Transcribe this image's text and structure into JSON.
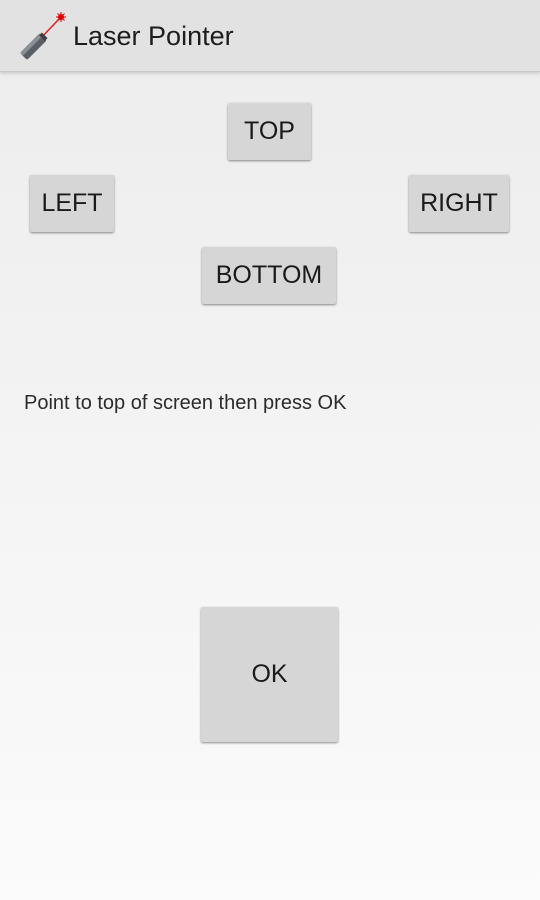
{
  "action_bar": {
    "title": "Laser Pointer",
    "icon": "laser-pointer-icon"
  },
  "direction_buttons": {
    "top": "TOP",
    "left": "LEFT",
    "right": "RIGHT",
    "bottom": "BOTTOM"
  },
  "instruction": "Point to top of screen then press OK",
  "ok_button": "OK",
  "colors": {
    "action_bar": "#e2e2e2",
    "button": "#d6d6d6",
    "laser_dot": "#e00000"
  }
}
